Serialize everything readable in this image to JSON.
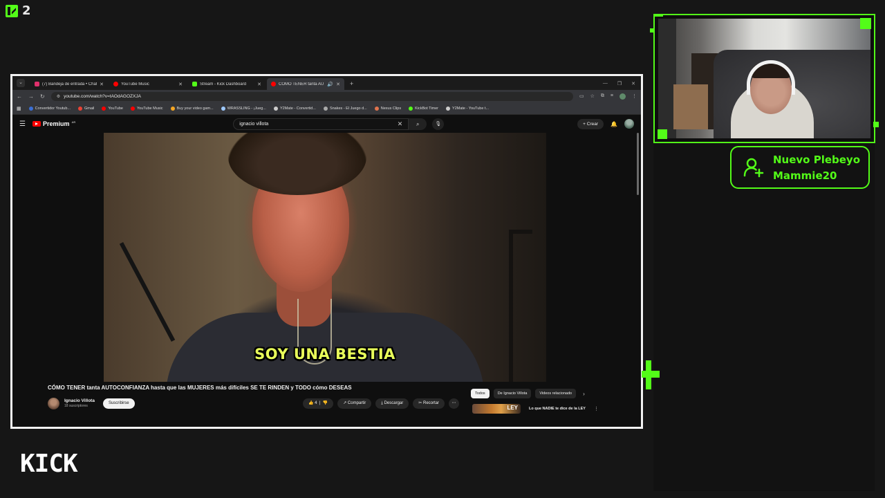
{
  "overlay": {
    "viewer_count": "2",
    "kick_logo_text": "KICK",
    "alert": {
      "title": "Nuevo Plebeyo",
      "username": "Mammie20"
    },
    "accent_color": "#53fc18"
  },
  "browser": {
    "tabs": [
      {
        "title": "(7) Bandeja de entrada • Chats",
        "favicon_color": "#e1306c"
      },
      {
        "title": "YouTube Music",
        "favicon_color": "#ff0000"
      },
      {
        "title": "Stream - Kick Dashboard",
        "favicon_color": "#53fc18"
      },
      {
        "title": "CÓMO TENER tanta AUTOC",
        "favicon_color": "#ff0000"
      }
    ],
    "new_tab": "+",
    "url": "youtube.com/watch?v=tAOdAGOZXJA",
    "bookmarks": [
      {
        "label": "Convertidor Youtub...",
        "color": "#3b6fd4"
      },
      {
        "label": "Gmail",
        "color": "#ea4335"
      },
      {
        "label": "YouTube",
        "color": "#ff0000"
      },
      {
        "label": "YouTube Music",
        "color": "#ff0000"
      },
      {
        "label": "Buy your video gam...",
        "color": "#f5a623"
      },
      {
        "label": "WRASSLING - ¡Jueg...",
        "color": "#9ec9ff"
      },
      {
        "label": "Y2Mate - Convertid...",
        "color": "#cccccc"
      },
      {
        "label": "Snakes - El Juego d...",
        "color": "#aaaaaa"
      },
      {
        "label": "Nexus Clips",
        "color": "#e0744e"
      },
      {
        "label": "KickBot Timer",
        "color": "#53fc18"
      },
      {
        "label": "Y2Mate - YouTube t...",
        "color": "#cccccc"
      }
    ]
  },
  "youtube": {
    "logo_text": "Premium",
    "logo_sup": "AR",
    "search_query": "ignacio villota",
    "create_label": "Crear",
    "video_subtitle": "SOY UNA BESTIA",
    "video_title": "CÓMO TENER tanta AUTOCONFIANZA hasta que las MUJERES más difíciles SE TE RINDEN y TODO cómo DESEAS",
    "channel_name": "Ignacio Villota",
    "subscribers": "18 suscriptores",
    "subscribe_label": "Suscribirse",
    "like_count": "4",
    "share_label": "Compartir",
    "download_label": "Descargar",
    "clip_label": "Recortar",
    "chips": [
      "Todos",
      "De Ignacio Villota",
      "Videos relacionado"
    ],
    "recommendation_thumb_text": "LEY",
    "recommendation_title": "Lo que NADIE te dice de la LEY"
  }
}
